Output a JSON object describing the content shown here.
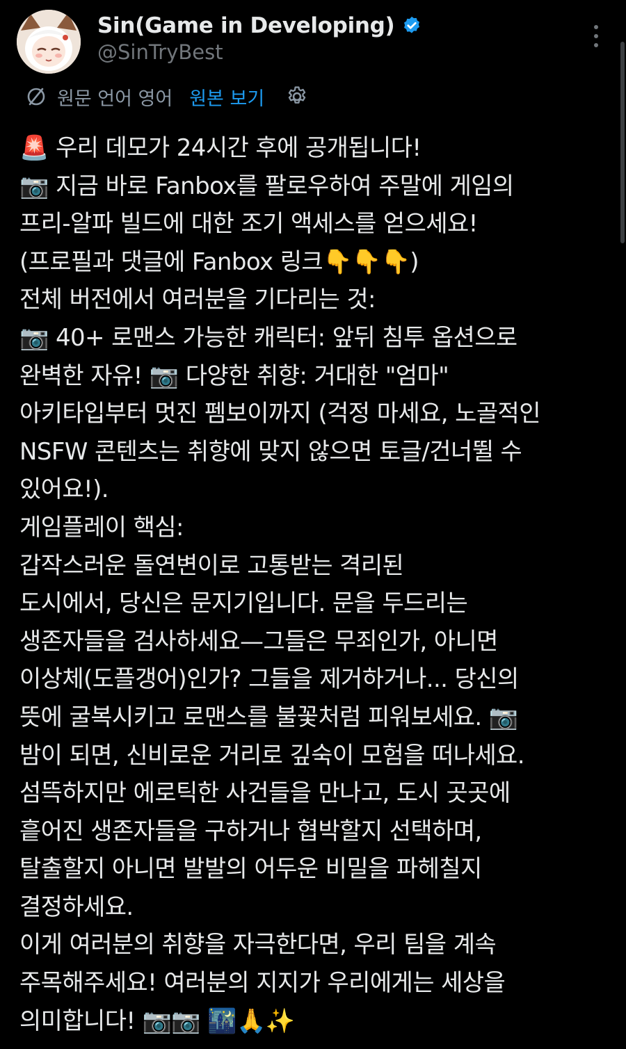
{
  "user": {
    "display_name": "Sin(Game in Developing)",
    "handle": "@SinTryBest",
    "verified": true,
    "avatar_icon": "anime-character-avatar"
  },
  "translation": {
    "label": "원문 언어 영어",
    "show_original": "원본 보기",
    "icon": "translate-icon",
    "settings_icon": "gear-icon"
  },
  "colors": {
    "background": "#000000",
    "text": "#e7e9ea",
    "secondary": "#71767b",
    "link": "#1d9bf0"
  },
  "tweet": {
    "lines": [
      "🚨 우리 데모가 24시간 후에 공개됩니다!",
      "📷 지금 바로 Fanbox를 팔로우하여 주말에 게임의",
      "프리-알파 빌드에 대한 조기 액세스를 얻으세요!",
      "(프로필과 댓글에 Fanbox 링크👇👇👇)",
      "전체 버전에서 여러분을 기다리는 것:",
      "📷 40+ 로맨스 가능한 캐릭터: 앞뒤 침투 옵션으로",
      "완벽한 자유! 📷 다양한 취향: 거대한 \"엄마\"",
      "아키타입부터 멋진 펨보이까지 (걱정 마세요, 노골적인",
      "NSFW 콘텐츠는 취향에 맞지 않으면 토글/건너뛸 수",
      "있어요!).",
      "게임플레이 핵심:",
      "갑작스러운 돌연변이로 고통받는 격리된",
      "도시에서, 당신은 문지기입니다. 문을 두드리는",
      "생존자들을 검사하세요—그들은 무죄인가, 아니면",
      "이상체(도플갱어)인가? 그들을 제거하거나... 당신의",
      "뜻에 굴복시키고 로맨스를 불꽃처럼 피워보세요. 📷",
      "밤이 되면, 신비로운 거리로 깊숙이 모험을 떠나세요.",
      "섬뜩하지만 에로틱한 사건들을 만나고, 도시 곳곳에",
      "흩어진 생존자들을 구하거나 협박할지 선택하며,",
      "탈출할지 아니면 발발의 어두운 비밀을 파헤칠지",
      "결정하세요.",
      "이게 여러분의 취향을 자극한다면, 우리 팀을 계속",
      "주목해주세요! 여러분의 지지가 우리에게는 세상을",
      "의미합니다! 📷📷 🌃🙏✨"
    ]
  }
}
